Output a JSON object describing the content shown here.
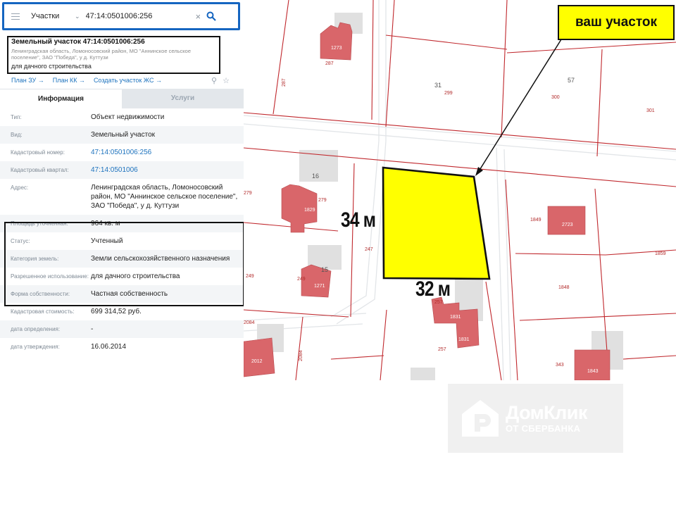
{
  "search": {
    "type_label": "Участки",
    "value": "47:14:0501006:256"
  },
  "card": {
    "title": "Земельный участок 47:14:0501006:256",
    "address_short": "Ленинградская область, Ломоносовский район, МО \"Аннинское сельское поселение\", ЗАО \"Победа\", у д. Куттузи",
    "use": "для дачного строительства",
    "links": [
      "План ЗУ →",
      "План КК →",
      "Создать участок ЖС →"
    ]
  },
  "tabs": {
    "info": "Информация",
    "services": "Услуги"
  },
  "rows": [
    {
      "label": "Тип:",
      "value": "Объект недвижимости"
    },
    {
      "label": "Вид:",
      "value": "Земельный участок"
    },
    {
      "label": "Кадастровый номер:",
      "value": "47:14:0501006:256"
    },
    {
      "label": "Кадастровый квартал:",
      "value": "47:14:0501006"
    },
    {
      "label": "Адрес:",
      "value": "Ленинградская область, Ломоносовский район, МО \"Аннинское сельское поселение\", ЗАО \"Победа\", у д. Куттузи"
    },
    {
      "label": "Площадь уточненная:",
      "value": "964 кв. м"
    },
    {
      "label": "Статус:",
      "value": "Учтенный"
    },
    {
      "label": "Категория земель:",
      "value": "Земли сельскохозяйственного назначения"
    },
    {
      "label": "Разрешенное использование:",
      "value": "для дачного строительства"
    },
    {
      "label": "Форма собственности:",
      "value": "Частная собственность"
    },
    {
      "label": "Кадастровая стоимость:",
      "value": "699 314,52 руб."
    },
    {
      "label": "дата определения:",
      "value": "-"
    },
    {
      "label": "дата утверждения:",
      "value": "16.06.2014"
    }
  ],
  "annotations": {
    "callout": "ваш участок",
    "side_vertical": "34 м",
    "side_horizontal": "32 м"
  },
  "map": {
    "plot_fill": "#ffff00",
    "boundary_color": "#c0282d",
    "building_color": "#d9666a",
    "labels": {
      "n287": "287",
      "n287b": "287",
      "n31": "31",
      "n299": "299",
      "n57": "57",
      "n300": "300",
      "n301": "301",
      "n16": "16",
      "n279": "279",
      "n279b": "279",
      "n247": "247",
      "n1849": "1849",
      "n1859": "1859",
      "n1848": "1848",
      "n249": "249",
      "n15": "15",
      "n257": "257",
      "n257b": "257",
      "n2084": "2084",
      "n2084b": "2084",
      "n343": "343",
      "b1": "1273",
      "b2": "1829",
      "b3": "2723",
      "b4": "1271",
      "b5": "1831",
      "b6": "1831",
      "b7": "1843",
      "b8": "2012"
    }
  },
  "watermark": {
    "name": "ДомКлик",
    "sub": "ОТ СБЕРБАНКА"
  }
}
